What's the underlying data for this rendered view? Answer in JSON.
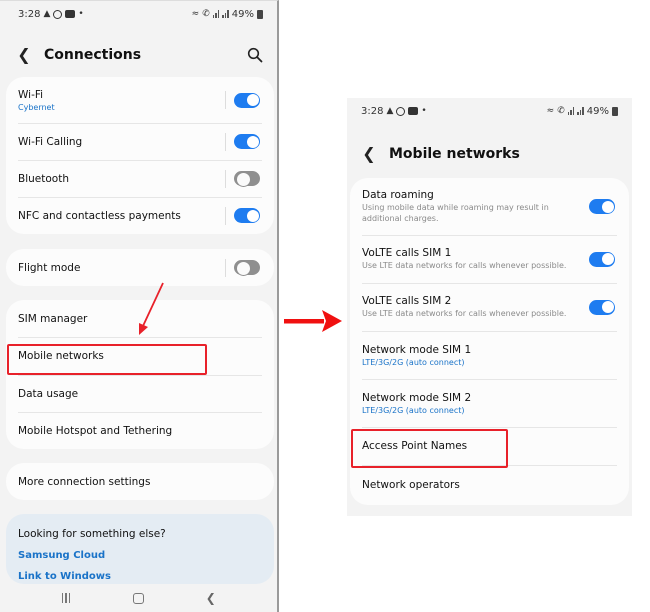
{
  "status_bar": {
    "time": "3:28",
    "battery": "49%",
    "left_icons": [
      "snapchat-icon",
      "whatsapp-icon",
      "youtube-icon",
      "dot-icon"
    ],
    "right_icons": [
      "wifi-icon",
      "wifi-calling-icon",
      "signal-sim1-icon",
      "signal-sim2-icon",
      "battery-icon"
    ]
  },
  "connections": {
    "title": "Connections",
    "groups": [
      {
        "items": [
          {
            "label": "Wi-Fi",
            "sublabel": "Cybernet",
            "toggle": true
          },
          {
            "label": "Wi-Fi Calling",
            "toggle": true
          },
          {
            "label": "Bluetooth",
            "toggle": false
          },
          {
            "label": "NFC and contactless payments",
            "toggle": true
          }
        ]
      },
      {
        "items": [
          {
            "label": "Flight mode",
            "toggle": false
          }
        ]
      },
      {
        "items": [
          {
            "label": "SIM manager"
          },
          {
            "label": "Mobile networks"
          },
          {
            "label": "Data usage"
          },
          {
            "label": "Mobile Hotspot and Tethering"
          }
        ]
      },
      {
        "items": [
          {
            "label": "More connection settings"
          }
        ]
      }
    ],
    "suggestions": {
      "title": "Looking for something else?",
      "links": [
        "Samsung Cloud",
        "Link to Windows"
      ]
    }
  },
  "mobile_networks": {
    "title": "Mobile networks",
    "items": [
      {
        "label": "Data roaming",
        "description": "Using mobile data while roaming may result in additional charges.",
        "toggle": true
      },
      {
        "label": "VoLTE calls SIM 1",
        "description": "Use LTE data networks for calls whenever possible.",
        "toggle": true
      },
      {
        "label": "VoLTE calls SIM 2",
        "description": "Use LTE data networks for calls whenever possible.",
        "toggle": true
      },
      {
        "label": "Network mode SIM 1",
        "sublabel": "LTE/3G/2G (auto connect)"
      },
      {
        "label": "Network mode SIM 2",
        "sublabel": "LTE/3G/2G (auto connect)"
      },
      {
        "label": "Access Point Names"
      },
      {
        "label": "Network operators"
      }
    ]
  },
  "annotations": {
    "highlight_color": "#e8212a",
    "highlighted_items": [
      "Mobile networks",
      "Access Point Names"
    ]
  },
  "colors": {
    "accent": "#1e7cf0",
    "link": "#1a73c8",
    "background": "#f3f3f3",
    "card": "#fcfcfc",
    "suggestion_card": "#e4ecf3"
  }
}
